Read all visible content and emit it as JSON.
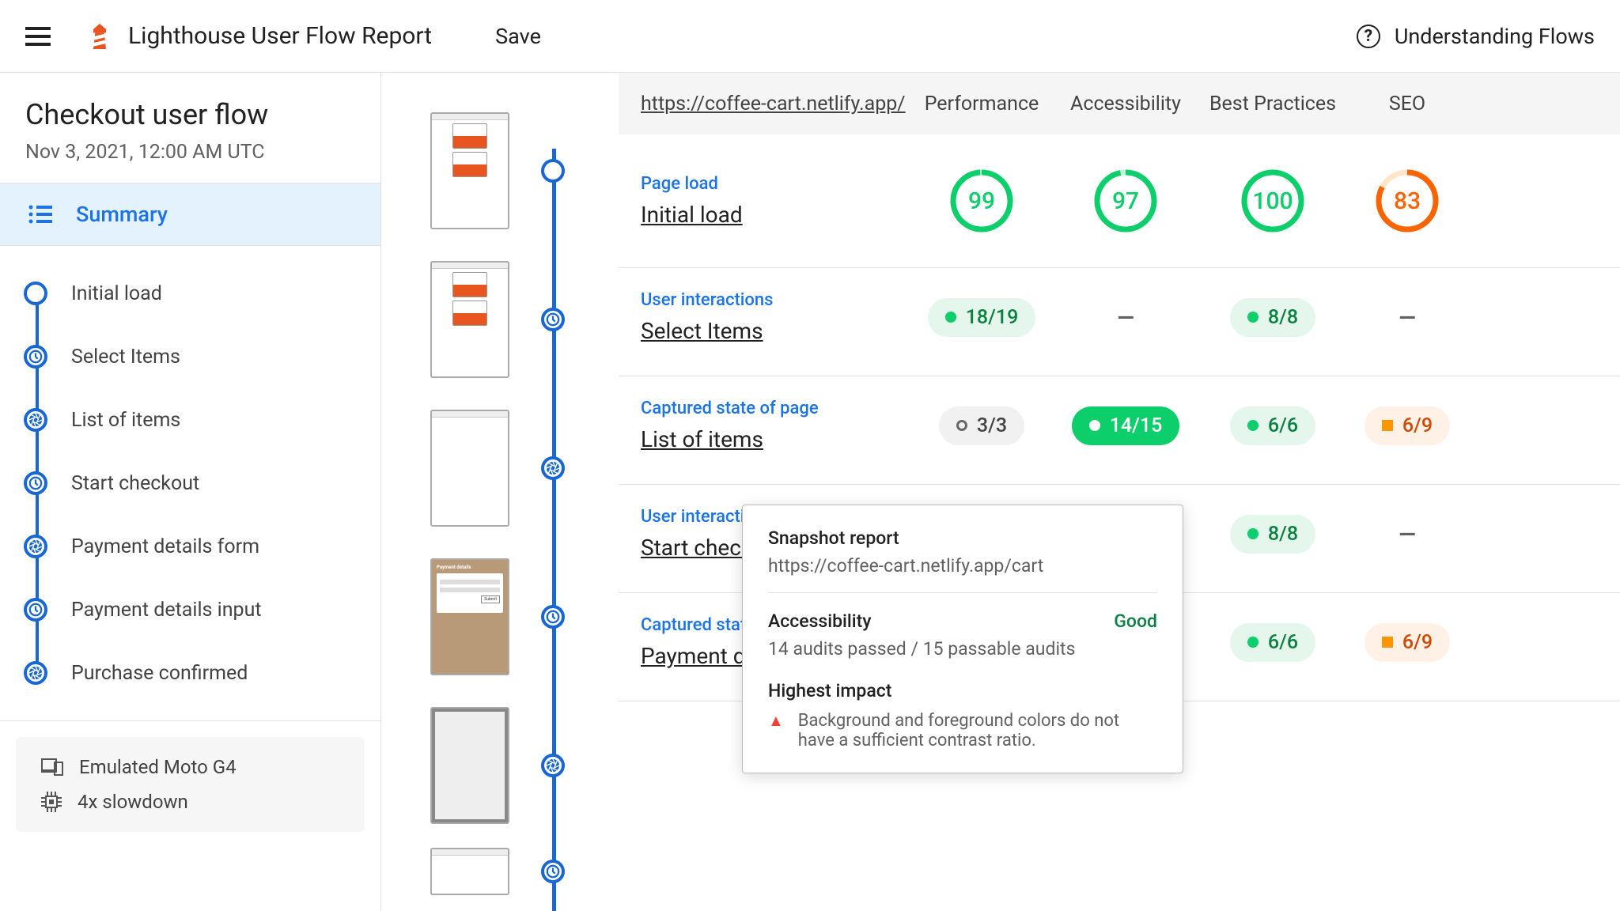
{
  "header": {
    "title": "Lighthouse User Flow Report",
    "save": "Save",
    "help": "Understanding Flows"
  },
  "flow": {
    "title": "Checkout user flow",
    "date": "Nov 3, 2021, 12:00 AM UTC"
  },
  "sidebar": {
    "summary": "Summary",
    "steps": [
      {
        "label": "Initial load",
        "icon": "circle"
      },
      {
        "label": "Select Items",
        "icon": "clock"
      },
      {
        "label": "List of items",
        "icon": "aperture"
      },
      {
        "label": "Start checkout",
        "icon": "clock"
      },
      {
        "label": "Payment details form",
        "icon": "aperture"
      },
      {
        "label": "Payment details input",
        "icon": "clock"
      },
      {
        "label": "Purchase confirmed",
        "icon": "aperture"
      }
    ]
  },
  "device": {
    "emulated": "Emulated Moto G4",
    "slowdown": "4x slowdown"
  },
  "table": {
    "url": "https://coffee-cart.netlify.app/",
    "columns": [
      "Performance",
      "Accessibility",
      "Best Practices",
      "SEO"
    ]
  },
  "rows": [
    {
      "type": "Page load",
      "name": "Initial load",
      "mode": "gauge",
      "cells": [
        {
          "v": "99",
          "c": "green",
          "p": 99
        },
        {
          "v": "97",
          "c": "green",
          "p": 97
        },
        {
          "v": "100",
          "c": "green",
          "p": 100
        },
        {
          "v": "83",
          "c": "orange",
          "p": 83
        }
      ]
    },
    {
      "type": "User interactions",
      "name": "Select Items",
      "mode": "pill",
      "cells": [
        {
          "v": "18/19",
          "c": "green"
        },
        {
          "v": "—",
          "c": "dash"
        },
        {
          "v": "8/8",
          "c": "green"
        },
        {
          "v": "—",
          "c": "dash"
        }
      ]
    },
    {
      "type": "Captured state of page",
      "name": "List of items",
      "mode": "pill",
      "cells": [
        {
          "v": "3/3",
          "c": "grey"
        },
        {
          "v": "14/15",
          "c": "green",
          "hover": true
        },
        {
          "v": "6/6",
          "c": "green"
        },
        {
          "v": "6/9",
          "c": "orange"
        }
      ]
    },
    {
      "type": "User interactions",
      "name": "Start checkout",
      "mode": "pill",
      "cells": [
        {
          "v": "",
          "c": "none"
        },
        {
          "v": "",
          "c": "none"
        },
        {
          "v": "8/8",
          "c": "green"
        },
        {
          "v": "—",
          "c": "dash"
        }
      ]
    },
    {
      "type": "Captured state of page",
      "name": "Payment details form",
      "mode": "pill",
      "truncated": true,
      "cells": [
        {
          "v": "",
          "c": "none"
        },
        {
          "v": "",
          "c": "none"
        },
        {
          "v": "6/6",
          "c": "green"
        },
        {
          "v": "6/9",
          "c": "orange"
        }
      ]
    }
  ],
  "tooltip": {
    "title": "Snapshot report",
    "url": "https://coffee-cart.netlify.app/cart",
    "category": "Accessibility",
    "rating": "Good",
    "audits": "14 audits passed / 15 passable audits",
    "impactTitle": "Highest impact",
    "impactText": "Background and foreground colors do not have a sufficient contrast ratio."
  }
}
